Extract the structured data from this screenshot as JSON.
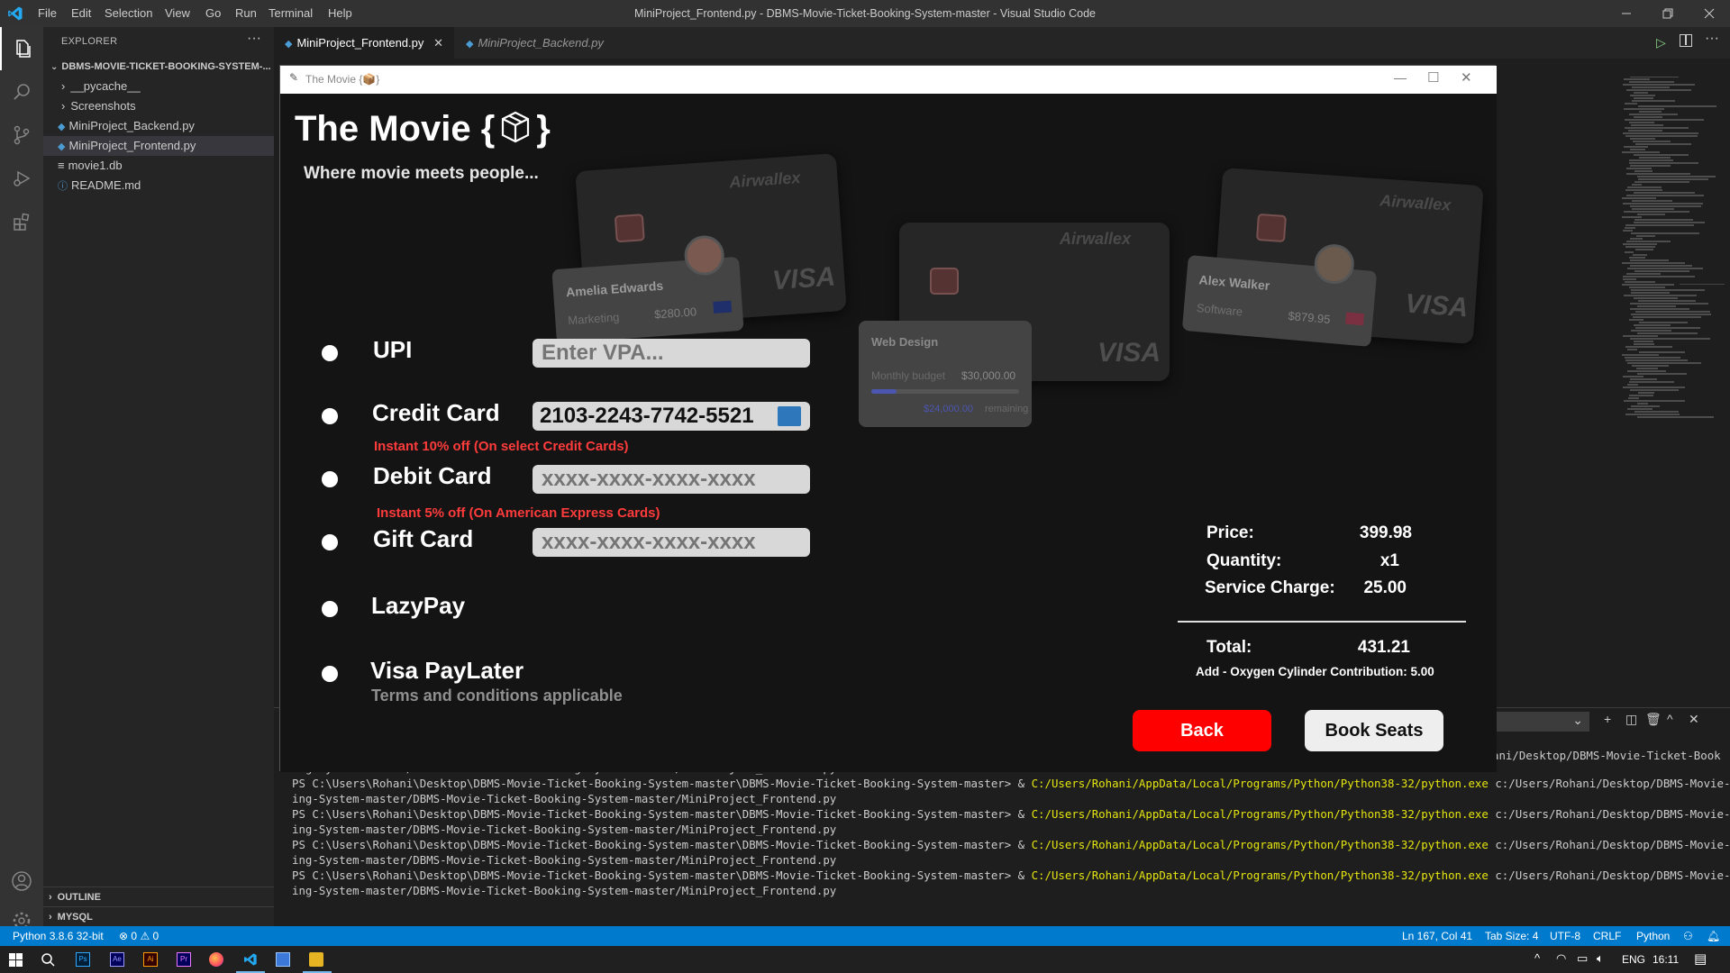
{
  "window": {
    "title": "MiniProject_Frontend.py - DBMS-Movie-Ticket-Booking-System-master - Visual Studio Code",
    "menu": [
      "File",
      "Edit",
      "Selection",
      "View",
      "Go",
      "Run",
      "Terminal",
      "Help"
    ]
  },
  "explorer": {
    "header": "EXPLORER",
    "root": "DBMS-MOVIE-TICKET-BOOKING-SYSTEM-...",
    "items": [
      "__pycache__",
      "Screenshots",
      "MiniProject_Backend.py",
      "MiniProject_Frontend.py",
      "movie1.db",
      "README.md"
    ],
    "outline": "OUTLINE",
    "mysql": "MYSQL"
  },
  "tabs": [
    "MiniProject_Frontend.py",
    "MiniProject_Backend.py"
  ],
  "app": {
    "window_title": "The Movie {📦}",
    "title": "The Movie {",
    "title_end": "}",
    "subtitle": "Where movie meets people...",
    "options": [
      {
        "label": "UPI",
        "placeholder": "Enter VPA..."
      },
      {
        "label": "Credit Card",
        "value": "2103-2243-7742-5521",
        "offer": "Instant 10% off (On select Credit Cards)"
      },
      {
        "label": "Debit Card",
        "placeholder": "xxxx-xxxx-xxxx-xxxx",
        "offer": "Instant 5% off (On American Express Cards)"
      },
      {
        "label": "Gift Card",
        "placeholder": "xxxx-xxxx-xxxx-xxxx"
      },
      {
        "label": "LazyPay"
      },
      {
        "label": "Visa PayLater",
        "note": "Terms and conditions applicable"
      }
    ],
    "summary": {
      "price_label": "Price:",
      "price": "399.98",
      "qty_label": "Quantity:",
      "qty": "x1",
      "service_label": "Service Charge:",
      "service": "25.00",
      "total_label": "Total:",
      "total": "431.21",
      "oxygen": "Add - Oxygen Cylinder Contribution: 5.00"
    },
    "back": "Back",
    "book": "Book Seats",
    "cards": {
      "brand": "Airwallex",
      "network": "VISA",
      "card1_name": "Amelia Edwards",
      "card1_role": "Marketing",
      "card1_amt": "$280.00",
      "card2_title": "Web Design",
      "card2_budget_label": "Monthly budget",
      "card2_budget": "$30,000.00",
      "card2_remaining": "$24,000.00",
      "card2_remaining_label": "remaining",
      "card3_name": "Alex Walker",
      "card3_role": "Software",
      "card3_amt": "$879.95"
    }
  },
  "terminal": {
    "prefix": "PS C:\\Users\\Rohani\\Desktop\\DBMS-Movie-Ticket-Booking-System-master\\DBMS-Movie-Ticket-Booking-System-master> & ",
    "exe": "C:/Users/Rohani/AppData/Local/Programs/Python/Python38-32/python.exe",
    "arg": " c:/Users/Rohani/Desktop/DBMS-Movie-Ticket-Book",
    "cont": "ing-System-master/DBMS-Movie-Ticket-Booking-System-master/MiniProject_Frontend.py",
    "top_right": "ani/Desktop/DBMS-Movie-Ticket-Book"
  },
  "status": {
    "python": "Python 3.8.6 32-bit",
    "problems": "0",
    "warnings": "0",
    "position": "Ln 167, Col 41",
    "tab_size": "Tab Size: 4",
    "encoding": "UTF-8",
    "eol": "CRLF",
    "language": "Python"
  },
  "taskbar": {
    "lang": "ENG",
    "time": "16:11"
  }
}
